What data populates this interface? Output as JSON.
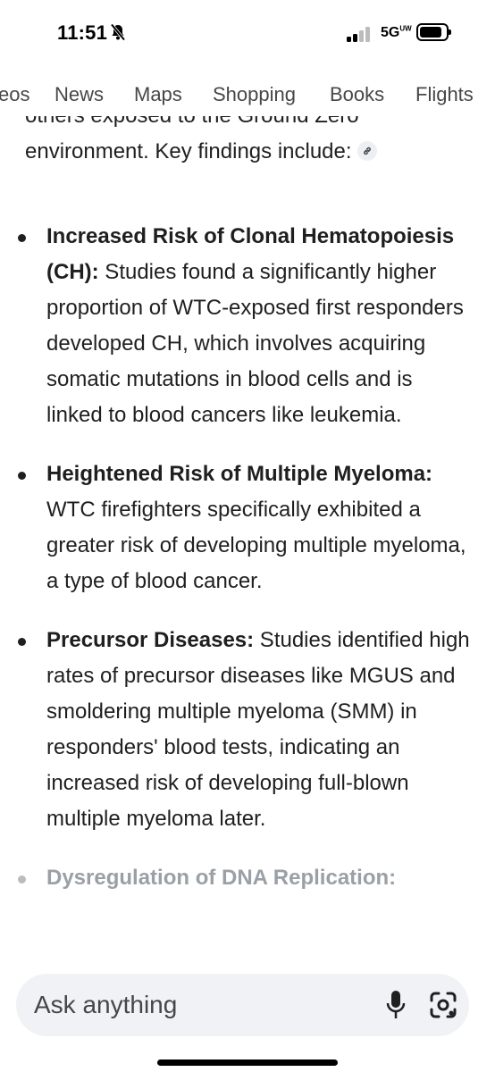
{
  "status_bar": {
    "time": "11:51",
    "network": "5G",
    "network_sup": "UW"
  },
  "tabs": [
    "eos",
    "News",
    "Maps",
    "Shopping",
    "Books",
    "Flights"
  ],
  "intro": {
    "text": "others exposed to the Ground Zero environment. Key findings include:",
    "link_icon": "link-icon"
  },
  "findings": [
    {
      "title": "Increased Risk of Clonal Hematopoiesis (CH):",
      "body": " Studies found a significantly higher proportion of WTC-exposed first responders developed CH, which involves acquiring somatic mutations in blood cells and is linked to blood cancers like leukemia."
    },
    {
      "title": "Heightened Risk of Multiple Myeloma:",
      "body": " WTC firefighters specifically exhibited a greater risk of developing multiple myeloma, a type of blood cancer."
    },
    {
      "title": "Precursor Diseases:",
      "body": " Studies identified high rates of precursor diseases like MGUS and smoldering multiple myeloma (SMM) in responders' blood tests, indicating an increased risk of developing full-blown multiple myeloma later."
    },
    {
      "title": "Dysregulation of DNA Replication:",
      "body": ""
    }
  ],
  "search": {
    "placeholder": "Ask anything",
    "mic_icon": "mic-icon",
    "lens_icon": "lens-icon"
  },
  "colors": {
    "text": "#1f1f1f",
    "tab_text": "#474747",
    "faded_text": "#9aa0a6",
    "search_bg": "#f0f2f5"
  }
}
